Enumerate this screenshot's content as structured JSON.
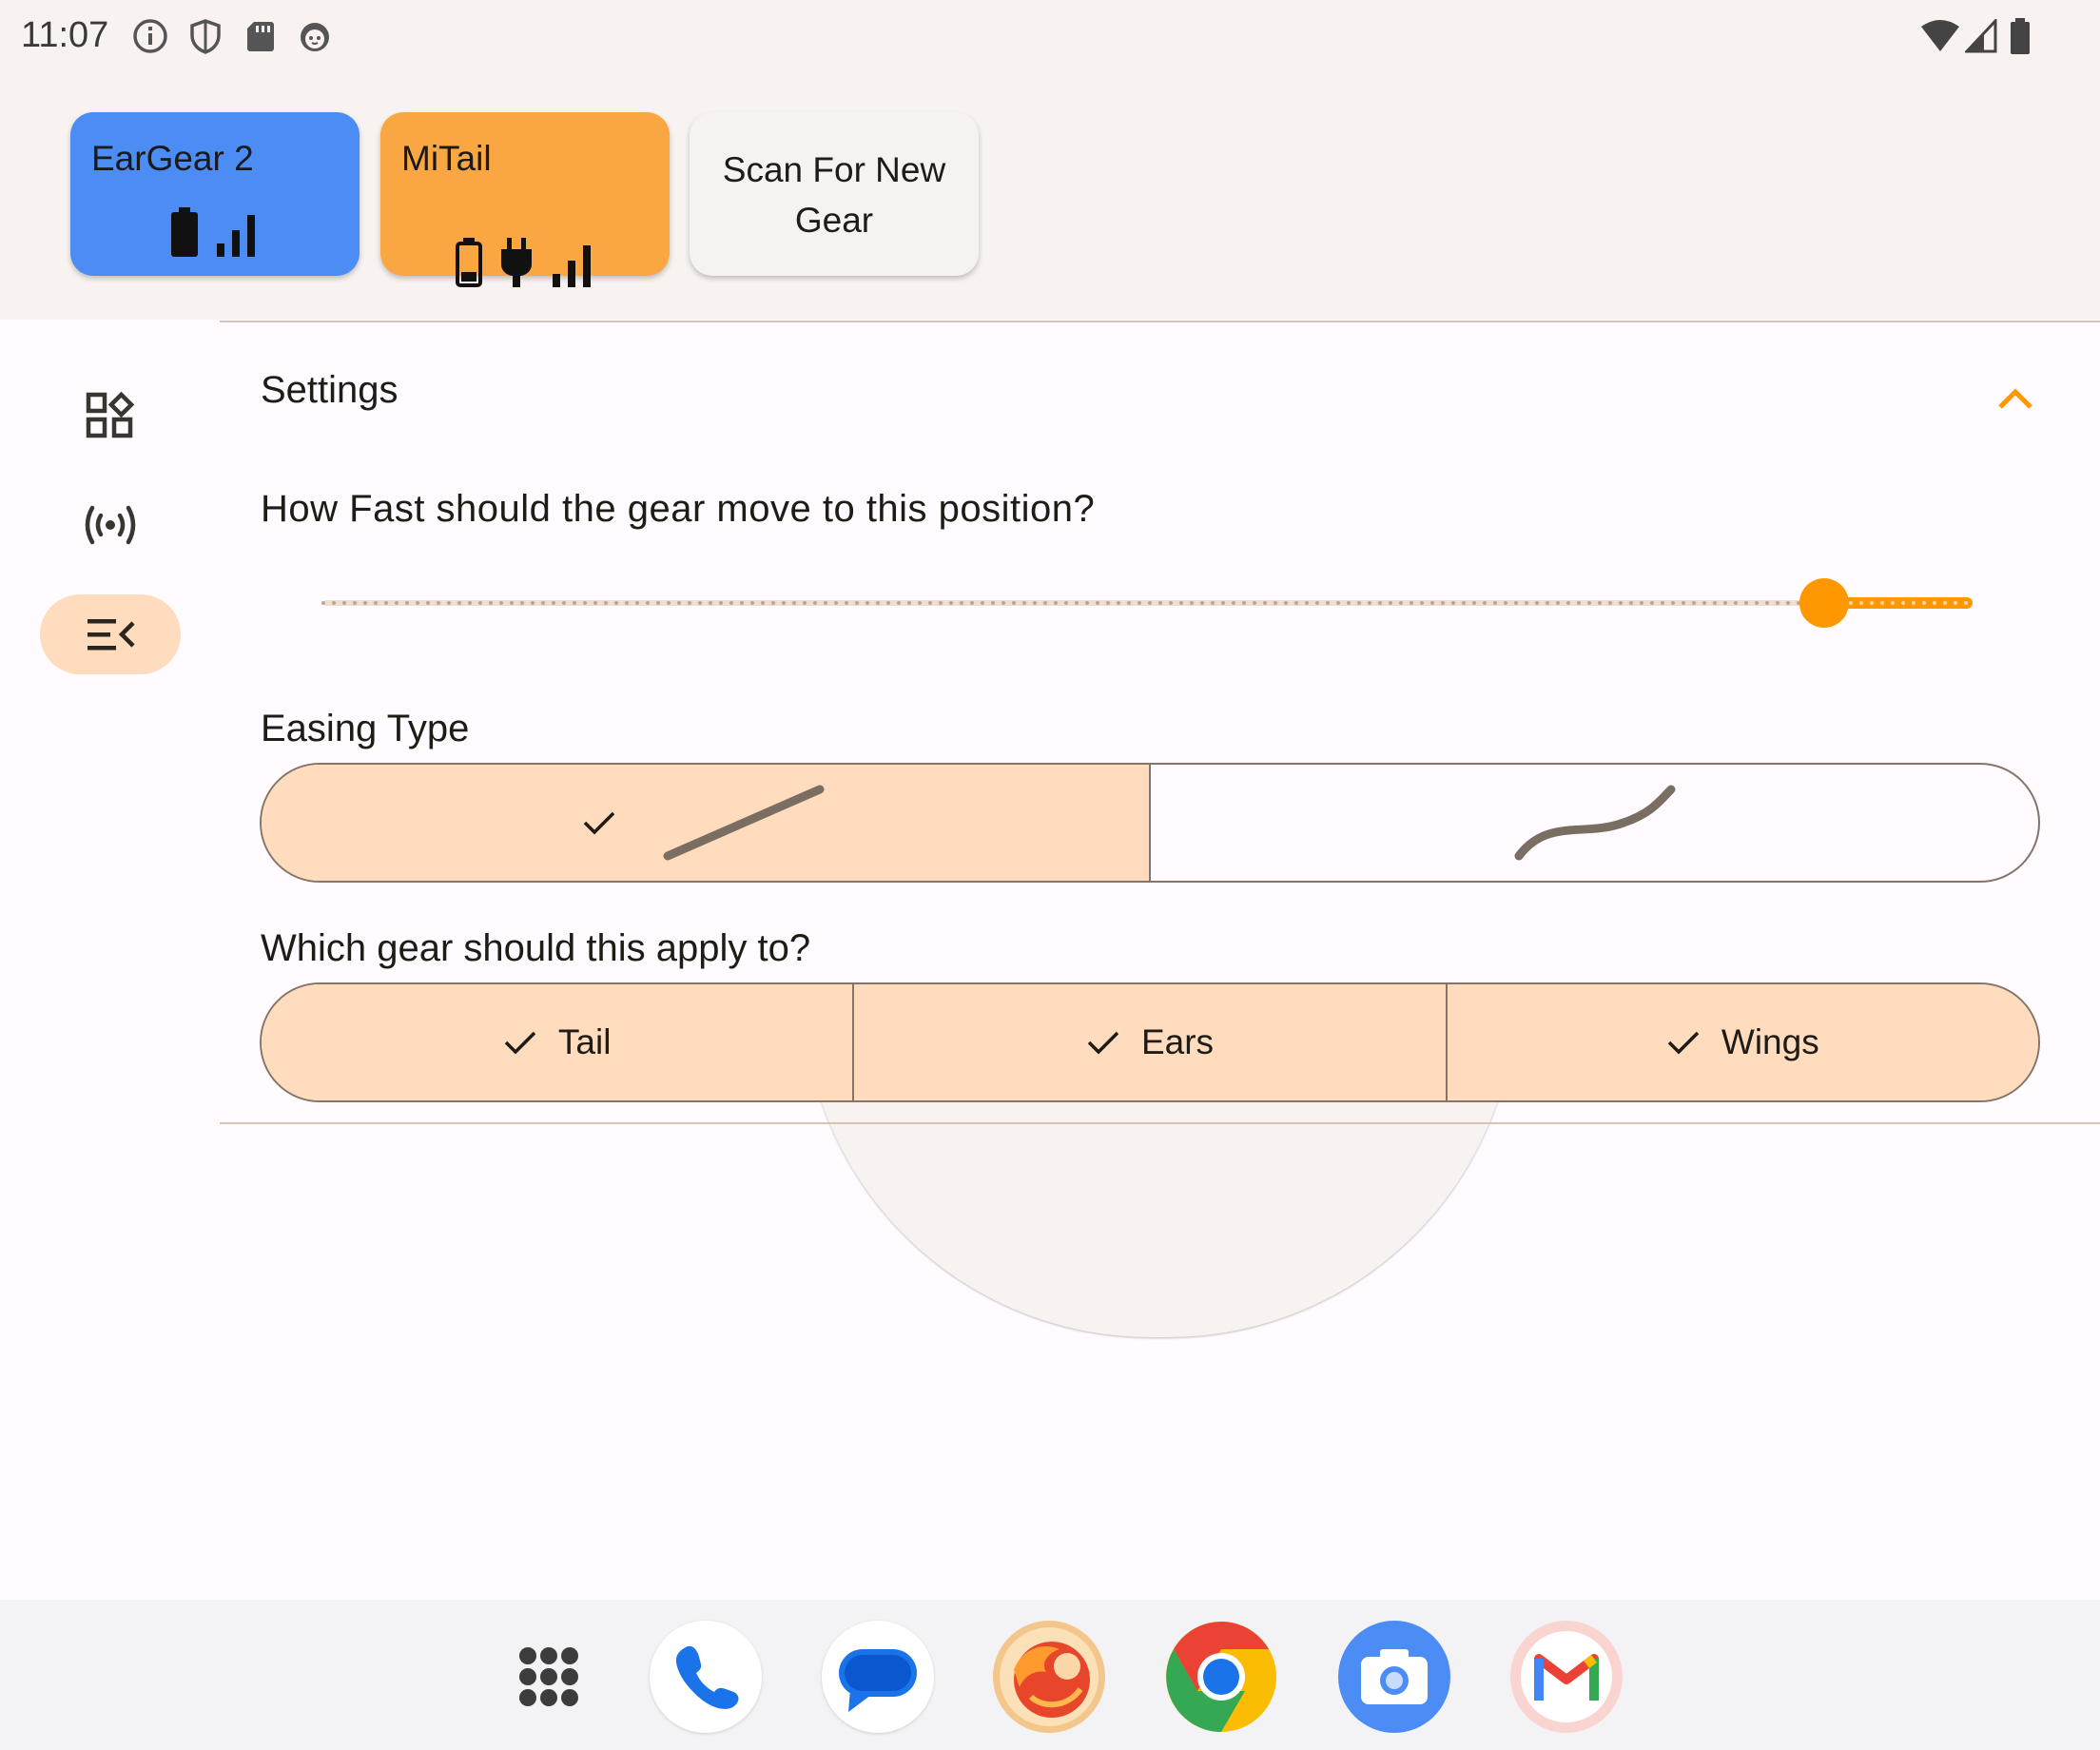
{
  "status_bar": {
    "time": "11:07",
    "left_icons": [
      "info-icon",
      "shield-icon",
      "sd-card-icon",
      "cat-face-icon"
    ],
    "right_icons": [
      "wifi-icon",
      "cell-signal-icon",
      "battery-icon"
    ]
  },
  "gear_cards": [
    {
      "name": "EarGear 2",
      "color": "#4c8df5",
      "icons": [
        "battery-full-icon",
        "signal-bars-icon"
      ]
    },
    {
      "name": "MiTail",
      "color": "#f9a743",
      "icons": [
        "battery-outline-icon",
        "charging-plug-icon",
        "signal-bars-icon"
      ]
    },
    {
      "name": "Scan For New Gear",
      "color": "#f5f2f0"
    }
  ],
  "nav_rail": [
    {
      "icon": "widgets-icon",
      "active": false
    },
    {
      "icon": "broadcast-icon",
      "active": false
    },
    {
      "icon": "menu-collapse-icon",
      "active": true
    }
  ],
  "settings": {
    "title": "Settings",
    "speed_question": "How Fast should the gear move to this position?",
    "speed_value": 0.91,
    "easing_label": "Easing Type",
    "easing_options": [
      {
        "icon": "linear-curve-icon",
        "selected": true
      },
      {
        "icon": "ease-in-out-curve-icon",
        "selected": false
      }
    ],
    "apply_label": "Which gear should this apply to?",
    "gear_options": [
      {
        "label": "Tail",
        "selected": true
      },
      {
        "label": "Ears",
        "selected": true
      },
      {
        "label": "Wings",
        "selected": true
      }
    ]
  },
  "colors": {
    "accent": "#ff9800",
    "selected_segment": "#ffdcbd",
    "outline": "#857467"
  },
  "dock": {
    "apps": [
      "app-drawer-icon",
      "phone-icon",
      "messages-icon",
      "firefox-icon",
      "chrome-icon",
      "camera-icon",
      "gmail-icon"
    ]
  }
}
